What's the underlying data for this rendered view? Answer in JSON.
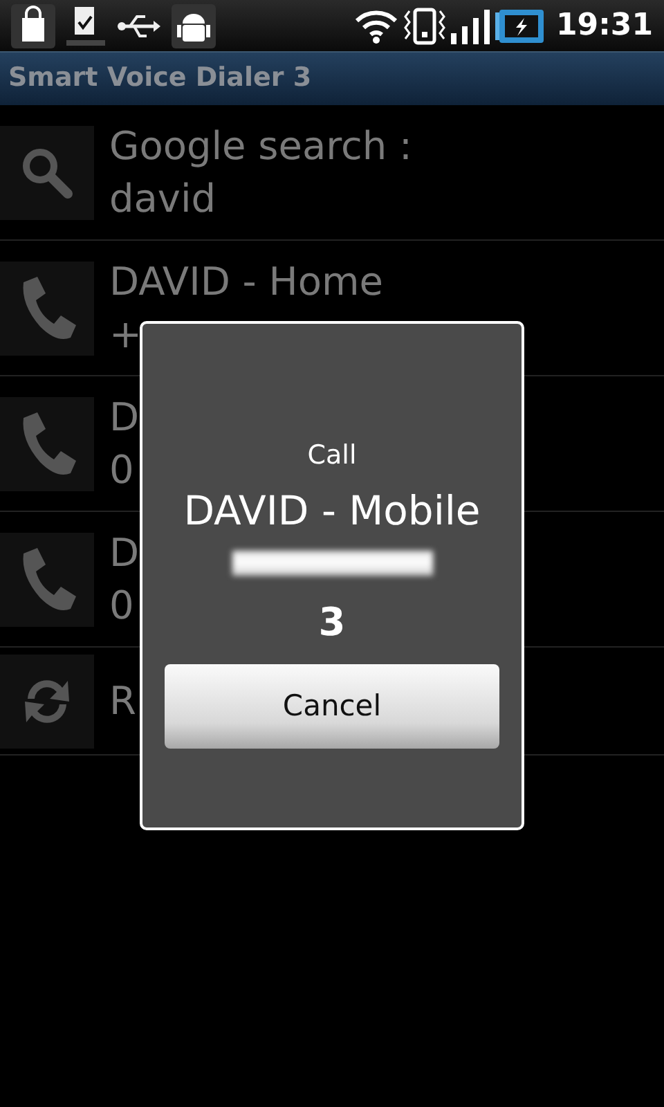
{
  "status_bar": {
    "time": "19:31"
  },
  "title_bar": {
    "title": "Smart Voice Dialer 3"
  },
  "results": [
    {
      "kind": "search",
      "lines": [
        "Google search :",
        "david"
      ]
    },
    {
      "kind": "call",
      "lines": [
        "DAVID - Home",
        "+"
      ]
    },
    {
      "kind": "call",
      "lines": [
        "D",
        "0"
      ]
    },
    {
      "kind": "call",
      "lines": [
        "D",
        "0"
      ]
    },
    {
      "kind": "refresh",
      "lines": [
        "R"
      ]
    }
  ],
  "dialog": {
    "heading": "Call",
    "name": "DAVID - Mobile",
    "countdown": "3",
    "button": "Cancel"
  }
}
